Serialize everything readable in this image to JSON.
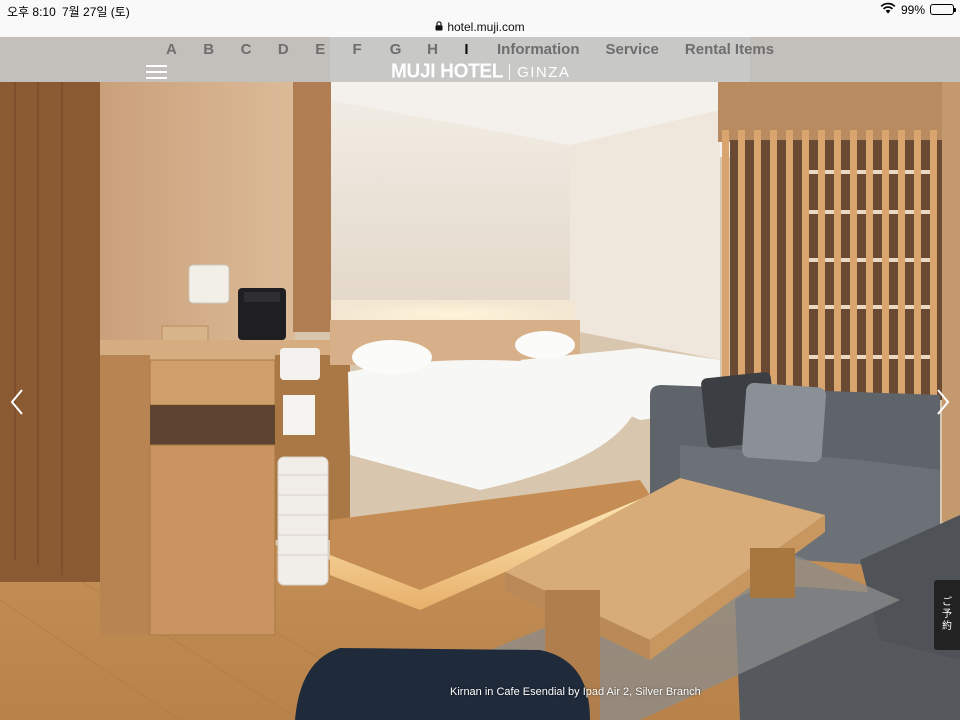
{
  "status_bar": {
    "time": "오후 8:10",
    "date": "7월 27일 (토)",
    "battery_percent_label": "99%",
    "battery_level": 0.99,
    "icons": [
      "wifi-icon",
      "battery-icon"
    ]
  },
  "browser": {
    "url": "hotel.muji.com",
    "lock_icon": "lock-icon"
  },
  "header": {
    "alphabet_nav": [
      "A",
      "B",
      "C",
      "D",
      "E",
      "F",
      "G",
      "H",
      "I"
    ],
    "active_letter": "I",
    "links": [
      {
        "label": "Information"
      },
      {
        "label": "Service"
      },
      {
        "label": "Rental Items"
      }
    ],
    "logo": {
      "main": "MUJI HOTEL",
      "sub": "GINZA"
    },
    "menu_icon": "hamburger-menu-icon"
  },
  "carousel": {
    "prev_icon": "chevron-left-icon",
    "next_icon": "chevron-right-icon",
    "caption": "Kirnan in Cafe Esendial by Ipad Air 2, Silver Branch"
  },
  "reserve_tab": {
    "label_lines": [
      "ご",
      "予",
      "約"
    ]
  },
  "colors": {
    "header_overlay": "#bebebe",
    "nav_text": "#6e6e6e",
    "active_text": "#111111",
    "wood": "#c99a63",
    "sofa": "#5f646a"
  }
}
